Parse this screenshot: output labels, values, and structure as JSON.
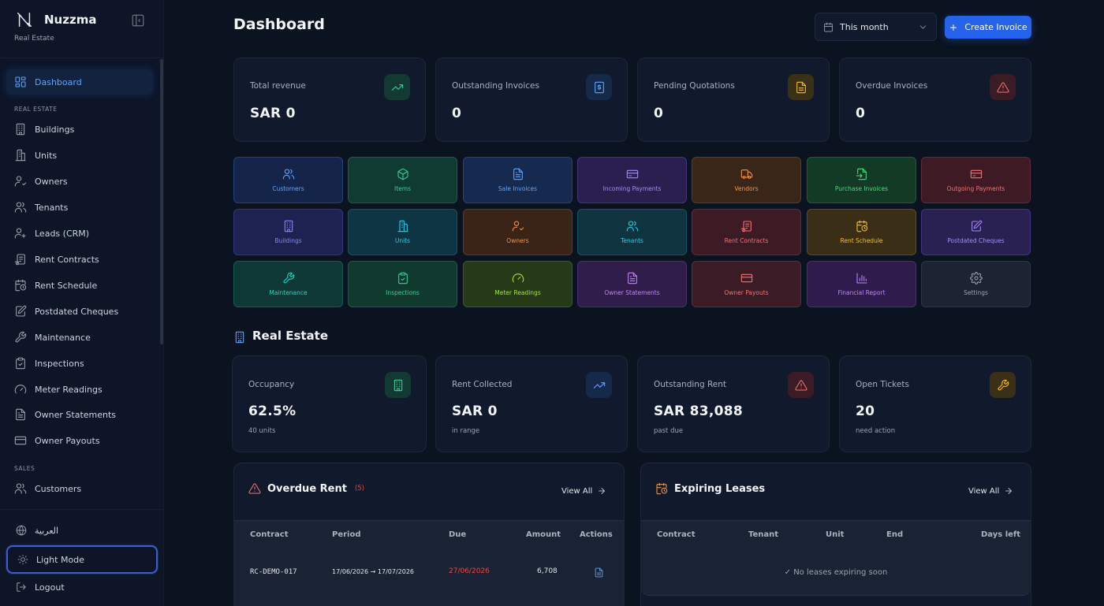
{
  "app": {
    "name": "Nuzzma",
    "subtitle": "Real Estate"
  },
  "sidebar": {
    "top_item": {
      "label": "Dashboard",
      "icon": "dashboard-icon"
    },
    "sections": [
      {
        "label": "REAL ESTATE"
      },
      {
        "label": "SALES"
      }
    ],
    "items": [
      {
        "label": "Buildings",
        "icon": "building-icon"
      },
      {
        "label": "Units",
        "icon": "units-icon"
      },
      {
        "label": "Owners",
        "icon": "user-check-icon"
      },
      {
        "label": "Tenants",
        "icon": "users-icon"
      },
      {
        "label": "Leads (CRM)",
        "icon": "user-plus-icon"
      },
      {
        "label": "Rent Contracts",
        "icon": "contract-icon"
      },
      {
        "label": "Rent Schedule",
        "icon": "calendar-clock-icon"
      },
      {
        "label": "Postdated Cheques",
        "icon": "edit-doc-icon"
      },
      {
        "label": "Maintenance",
        "icon": "wrench-icon"
      },
      {
        "label": "Inspections",
        "icon": "clipboard-icon"
      },
      {
        "label": "Meter Readings",
        "icon": "gauge-icon"
      },
      {
        "label": "Owner Statements",
        "icon": "file-icon"
      },
      {
        "label": "Owner Payouts",
        "icon": "wallet-icon"
      }
    ],
    "sales_items": [
      {
        "label": "Customers",
        "icon": "users-icon"
      }
    ],
    "bottom": {
      "language": "العربية",
      "theme": "Light Mode",
      "logout": "Logout"
    }
  },
  "header": {
    "title": "Dashboard",
    "range": "This month",
    "create_label": "Create Invoice"
  },
  "stats": [
    {
      "label": "Total revenue",
      "value": "SAR 0",
      "icon": "trend-up-icon",
      "color": "#34d399"
    },
    {
      "label": "Outstanding Invoices",
      "value": "0",
      "icon": "invoice-dollar-icon",
      "color": "#60a5fa"
    },
    {
      "label": "Pending Quotations",
      "value": "0",
      "icon": "document-icon",
      "color": "#fbbf24"
    },
    {
      "label": "Overdue Invoices",
      "value": "0",
      "icon": "alert-triangle-icon",
      "color": "#f87171"
    }
  ],
  "tiles": [
    {
      "label": "Customers",
      "icon": "users-icon",
      "color": "#60a5fa"
    },
    {
      "label": "Items",
      "icon": "box-icon",
      "color": "#34d399"
    },
    {
      "label": "Sale Invoices",
      "icon": "file-icon",
      "color": "#60a5fa"
    },
    {
      "label": "Incoming Payments",
      "icon": "card-icon",
      "color": "#a78bfa"
    },
    {
      "label": "Vendors",
      "icon": "truck-icon",
      "color": "#fb923c"
    },
    {
      "label": "Purchase Invoices",
      "icon": "file-import-icon",
      "color": "#4ade80"
    },
    {
      "label": "Outgoing Payments",
      "icon": "card-icon",
      "color": "#f87171"
    },
    {
      "label": "Buildings",
      "icon": "building-icon",
      "color": "#818cf8"
    },
    {
      "label": "Units",
      "icon": "units-icon",
      "color": "#22d3ee"
    },
    {
      "label": "Owners",
      "icon": "user-check-icon",
      "color": "#fb923c"
    },
    {
      "label": "Tenants",
      "icon": "users-icon",
      "color": "#22d3ee"
    },
    {
      "label": "Rent Contracts",
      "icon": "contract-icon",
      "color": "#f87171"
    },
    {
      "label": "Rent Schedule",
      "icon": "calendar-clock-icon",
      "color": "#fbbf24"
    },
    {
      "label": "Postdated Cheques",
      "icon": "edit-doc-icon",
      "color": "#a78bfa"
    },
    {
      "label": "Maintenance",
      "icon": "wrench-icon",
      "color": "#2dd4bf"
    },
    {
      "label": "Inspections",
      "icon": "clipboard-icon",
      "color": "#34d399"
    },
    {
      "label": "Meter Readings",
      "icon": "gauge-icon",
      "color": "#a3e635"
    },
    {
      "label": "Owner Statements",
      "icon": "file-icon",
      "color": "#c084fc"
    },
    {
      "label": "Owner Payouts",
      "icon": "wallet-icon",
      "color": "#f87171"
    },
    {
      "label": "Financial Report",
      "icon": "bar-chart-icon",
      "color": "#c084fc"
    },
    {
      "label": "Settings",
      "icon": "gear-icon",
      "color": "#9ca3af"
    }
  ],
  "real_estate": {
    "title": "Real Estate",
    "stats": [
      {
        "label": "Occupancy",
        "value": "62.5%",
        "sub": "40 units",
        "icon": "building-icon",
        "color": "#34d399"
      },
      {
        "label": "Rent Collected",
        "value": "SAR 0",
        "sub": "in range",
        "icon": "trend-up-icon",
        "color": "#60a5fa"
      },
      {
        "label": "Outstanding Rent",
        "value": "SAR 83,088",
        "sub": "past due",
        "icon": "alert-triangle-icon",
        "color": "#f87171"
      },
      {
        "label": "Open Tickets",
        "value": "20",
        "sub": "need action",
        "icon": "wrench-icon",
        "color": "#fbbf24"
      }
    ]
  },
  "overdue_rent": {
    "title": "Overdue Rent",
    "count": "(5)",
    "view_all": "View All",
    "columns": [
      "Contract",
      "Period",
      "Due",
      "Amount",
      "Actions"
    ],
    "rows": [
      {
        "contract": "RC-DEMO-017",
        "period": "17/06/2026 → 17/07/2026",
        "due": "27/06/2026",
        "amount": "6,708"
      }
    ]
  },
  "expiring_leases": {
    "title": "Expiring Leases",
    "view_all": "View All",
    "columns": [
      "Contract",
      "Tenant",
      "Unit",
      "End",
      "Days left"
    ],
    "empty": "✓ No leases expiring soon"
  }
}
